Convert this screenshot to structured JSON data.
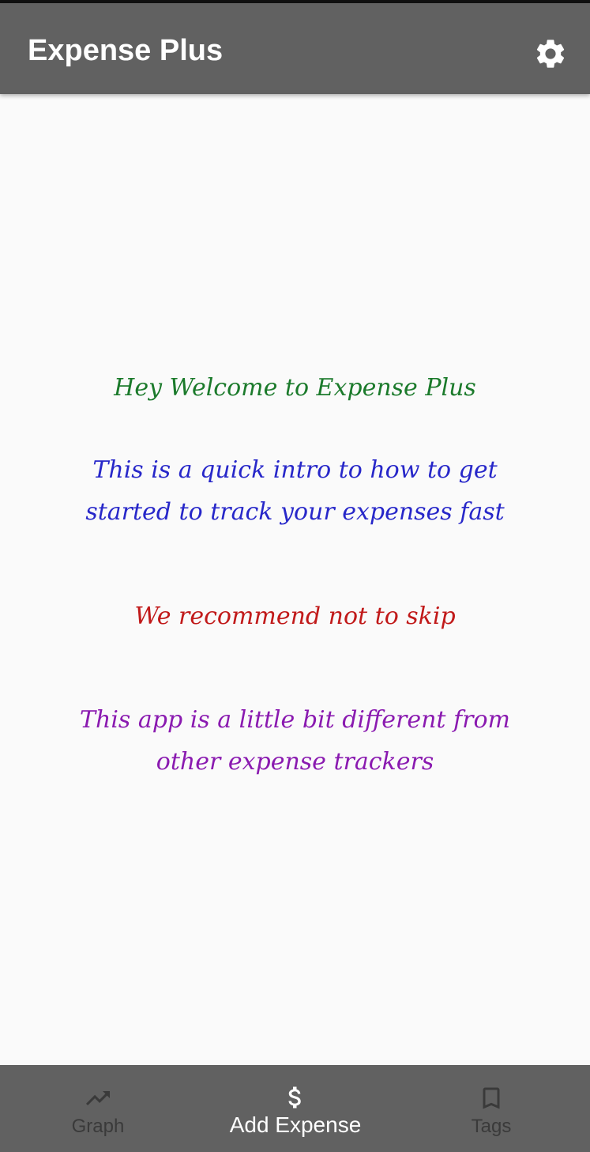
{
  "app_bar": {
    "title": "Expense Plus",
    "settings_icon": "gear-icon"
  },
  "intro": {
    "welcome": "Hey Welcome to Expense Plus",
    "quick_intro": {
      "line1": "This is a quick intro to how to get",
      "line2": "started to track your expenses fast"
    },
    "recommend": "We recommend not to skip",
    "different": {
      "line1": "This app is a little bit different from",
      "line2": "other expense trackers"
    }
  },
  "bottom_nav": {
    "items": [
      {
        "label": "Graph",
        "icon": "trending-up-icon",
        "active": false
      },
      {
        "label": "Add Expense",
        "icon": "dollar-icon",
        "active": true
      },
      {
        "label": "Tags",
        "icon": "bookmark-icon",
        "active": false
      }
    ]
  },
  "colors": {
    "app_bar": "#616161",
    "background": "#fafafa",
    "welcome_text": "#1b7a2b",
    "intro_text": "#2727c9",
    "recommend_text": "#c11a1a",
    "different_text": "#8a1ab0",
    "nav_active": "#ffffff",
    "nav_inactive": "#3a3a3a"
  }
}
